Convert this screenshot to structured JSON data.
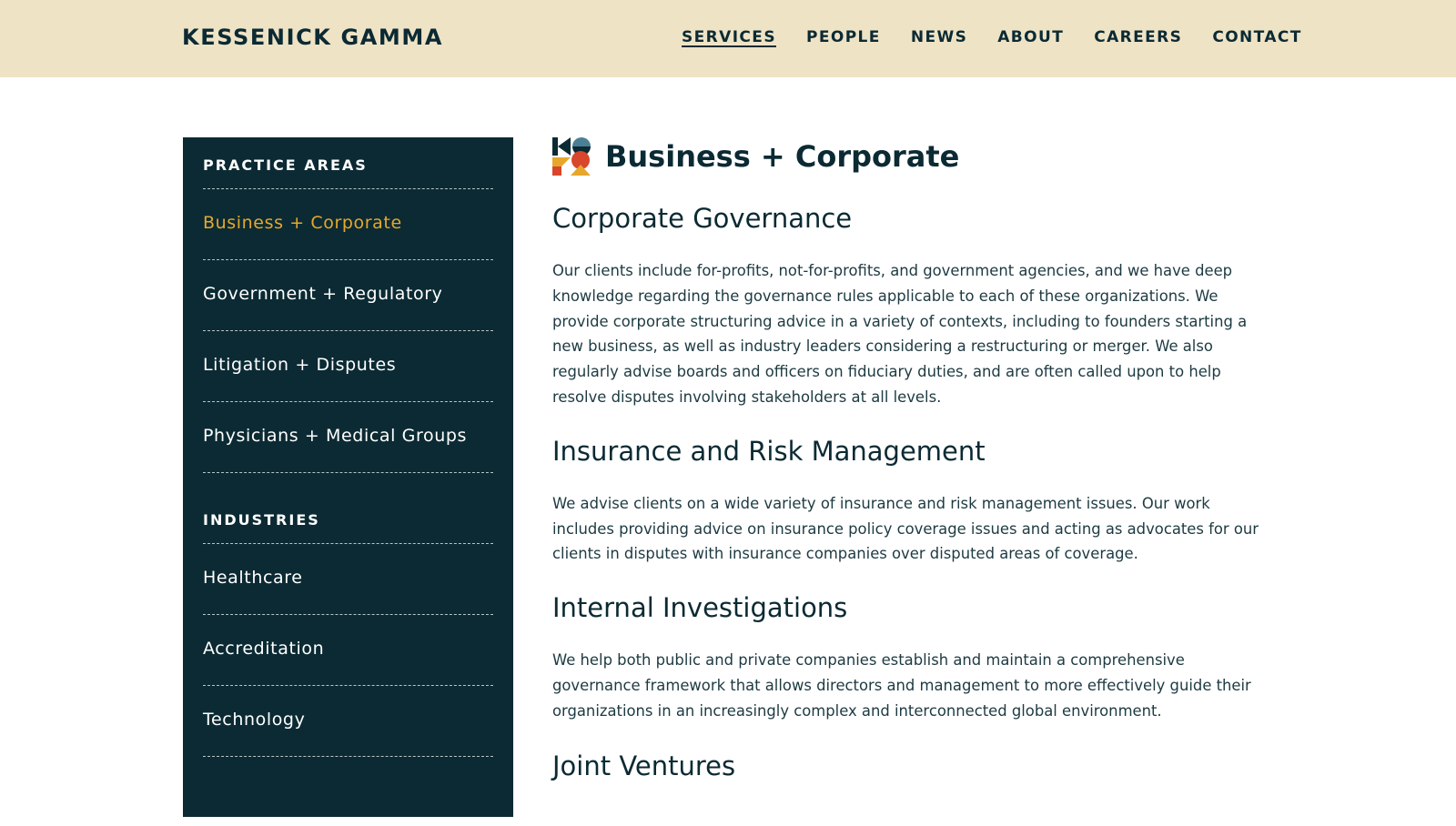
{
  "header": {
    "brand": "KESSENICK GAMMA",
    "nav": [
      {
        "label": "SERVICES",
        "active": true
      },
      {
        "label": "PEOPLE"
      },
      {
        "label": "NEWS"
      },
      {
        "label": "ABOUT"
      },
      {
        "label": "CAREERS"
      },
      {
        "label": "CONTACT"
      }
    ]
  },
  "sidebar": {
    "practice_heading": "PRACTICE AREAS",
    "practice_items": [
      {
        "label": "Business + Corporate",
        "active": true
      },
      {
        "label": "Government + Regulatory"
      },
      {
        "label": "Litigation + Disputes"
      },
      {
        "label": "Physicians + Medical Groups"
      }
    ],
    "industries_heading": "INDUSTRIES",
    "industry_items": [
      {
        "label": "Healthcare"
      },
      {
        "label": "Accreditation"
      },
      {
        "label": "Technology"
      }
    ]
  },
  "main": {
    "title": "Business + Corporate",
    "sections": [
      {
        "heading": "Corporate Governance",
        "body": "Our clients include for-profits, not-for-profits, and government agencies, and we have deep knowledge regarding the governance rules applicable to each of these organizations.  We provide corporate structuring advice in a variety of contexts, including to founders starting a new business, as well as industry leaders considering a restructuring or merger.  We also regularly advise boards and officers on fiduciary duties, and are often called upon to help resolve disputes involving stakeholders at all levels."
      },
      {
        "heading": "Insurance and Risk Management",
        "body": "We advise clients on a wide variety of insurance and risk management issues. Our work includes providing advice on insurance policy coverage issues and acting as advocates for our clients in disputes with insurance companies over disputed areas of coverage."
      },
      {
        "heading": "Internal Investigations",
        "body": "We help both public and private companies establish and maintain a comprehensive governance framework that allows directors and management to more effectively guide their organizations in an increasingly complex and interconnected global environment."
      },
      {
        "heading": "Joint Ventures"
      }
    ]
  },
  "colors": {
    "header_bg": "#efe3c6",
    "navy": "#0b2a33",
    "accent_gold": "#e6a82c",
    "accent_red": "#d8462c",
    "accent_blue": "#4b7f95"
  },
  "icons": {
    "title_mark": "kg-geometric-logo-icon"
  }
}
